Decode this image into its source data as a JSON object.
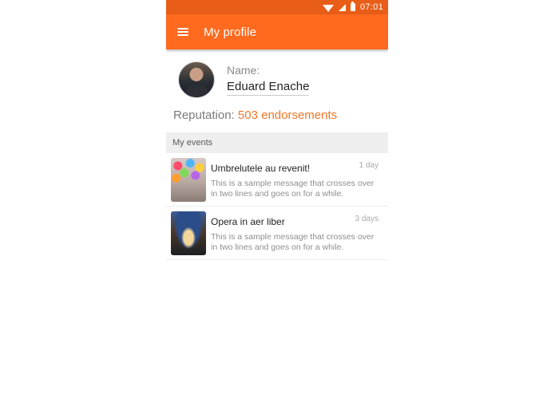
{
  "status_bar": {
    "time": "07:01",
    "icons": [
      "wifi-icon",
      "signal-icon",
      "battery-icon"
    ]
  },
  "app_bar": {
    "title": "My profile",
    "menu_icon": "menu-icon"
  },
  "profile": {
    "name_label": "Name:",
    "name": "Eduard Enache",
    "reputation_label": "Reputation:",
    "reputation_value": "503 endorsements"
  },
  "events_section": {
    "header": "My events",
    "items": [
      {
        "title": "Umbrelutele au revenit!",
        "description": "This is a sample message that crosses over in two lines and goes on for a while.",
        "time": "1 day",
        "thumbnail": "umbrellas-photo"
      },
      {
        "title": "Opera in aer liber",
        "description": "This is a sample message that crosses over in two lines and goes on for a while.",
        "time": "3 days",
        "thumbnail": "opera-photo"
      }
    ]
  },
  "colors": {
    "status_bar": "#e85d17",
    "app_bar": "#ff6a1f",
    "accent": "#f07628",
    "section_bg": "#eeeeee"
  }
}
